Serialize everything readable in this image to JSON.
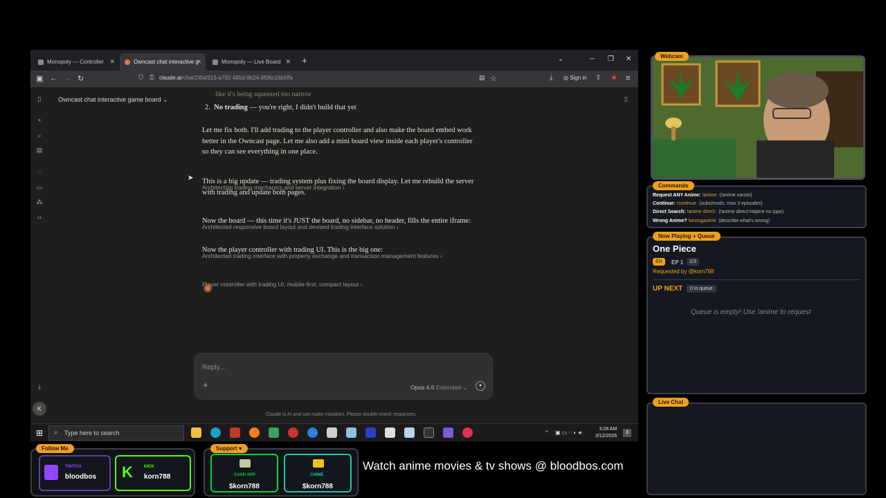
{
  "browser": {
    "tabs": [
      {
        "label": "Monopoly — Controller",
        "active": false
      },
      {
        "label": "Owncast chat interactive game",
        "active": true
      },
      {
        "label": "Monopoly — Live Board",
        "active": false
      }
    ],
    "new_tab": "+",
    "url_host": "claude.ai",
    "url_path": "/chat/24faf313-a792-485d-9b24-8f08c16b5ffa",
    "sign_in": "Sign in"
  },
  "chat": {
    "title": "Owncast chat interactive game board",
    "avatar_initial": "K",
    "cut_text": "like it's being squeezed too narrow",
    "list_item_2_num": "2.",
    "list_item_2_bold": "No trading",
    "list_item_2_rest": " — you're right, I didn't build that yet",
    "messages": [
      "Let me fix both. I'll add trading to the player controller and also make the board embed work better in the Owncast page. Let me also add a mini board view inside each player's controller so they can see everything in one place.",
      "This is a big update — trading system plus fixing the board display. Let me rebuild the server with trading and update both pages.",
      "Now the board — this time it's JUST the board, no sidebar, no header, fills the entire iframe:",
      "Now the player controller with trading UI. This is the big one:"
    ],
    "thinking": [
      "Architecting trading mechanics and server integration",
      "Architected responsive board layout and devised trading interface solution",
      "Architected trading interface with property exchange and transaction management features",
      "Player controller with trading UI, mobile-first, compact layout"
    ],
    "composer_placeholder": "Reply...",
    "model": "Opus 4.6",
    "model_mode": "Extended",
    "disclaimer": "Claude is AI and can make mistakes. Please double-check responses."
  },
  "taskbar": {
    "search_placeholder": "Type here to search",
    "time": "3:28 AM",
    "date": "3/12/2026",
    "notifications": "3"
  },
  "overlay": {
    "webcam_label": "Webcam",
    "commands_label": "Commands",
    "commands": [
      {
        "name": "Request ANY Anime:",
        "cmd": "!anime",
        "desc": "(!anime naruto)"
      },
      {
        "name": "Continue:",
        "cmd": "!continue",
        "desc": "(subs/mods, max 3 episodes)"
      },
      {
        "name": "Direct Search:",
        "cmd": "!anime direct:",
        "desc": "(!anime direct:Hajime no Ippo)"
      },
      {
        "name": "Wrong Anime?",
        "cmd": "!wronganime",
        "desc": "(describe what's wrong)"
      }
    ],
    "now_playing_label": "Now Playing + Queue",
    "now_playing_title": "One Piece",
    "lang_badge": "EN",
    "episode": "EP 1",
    "episode_count": "1/3",
    "requested_by": "Requested by @korn788",
    "up_next": "UP NEXT",
    "queue_count": "0 in queue",
    "queue_empty": "Queue is empty! Use !anime to request",
    "live_chat_label": "Live Chat",
    "follow_label": "Follow Me",
    "twitch_platform": "TWITCH",
    "twitch_name": "bloodbos",
    "kick_platform": "KICK",
    "kick_name": "korn788",
    "support_label": "Support",
    "cashapp_platform": "CASH APP",
    "cashapp_name": "$korn788",
    "chime_platform": "CHIME",
    "chime_name": "$korn788",
    "watch_banner": "Watch anime movies & tv shows @ bloodbos.com"
  }
}
